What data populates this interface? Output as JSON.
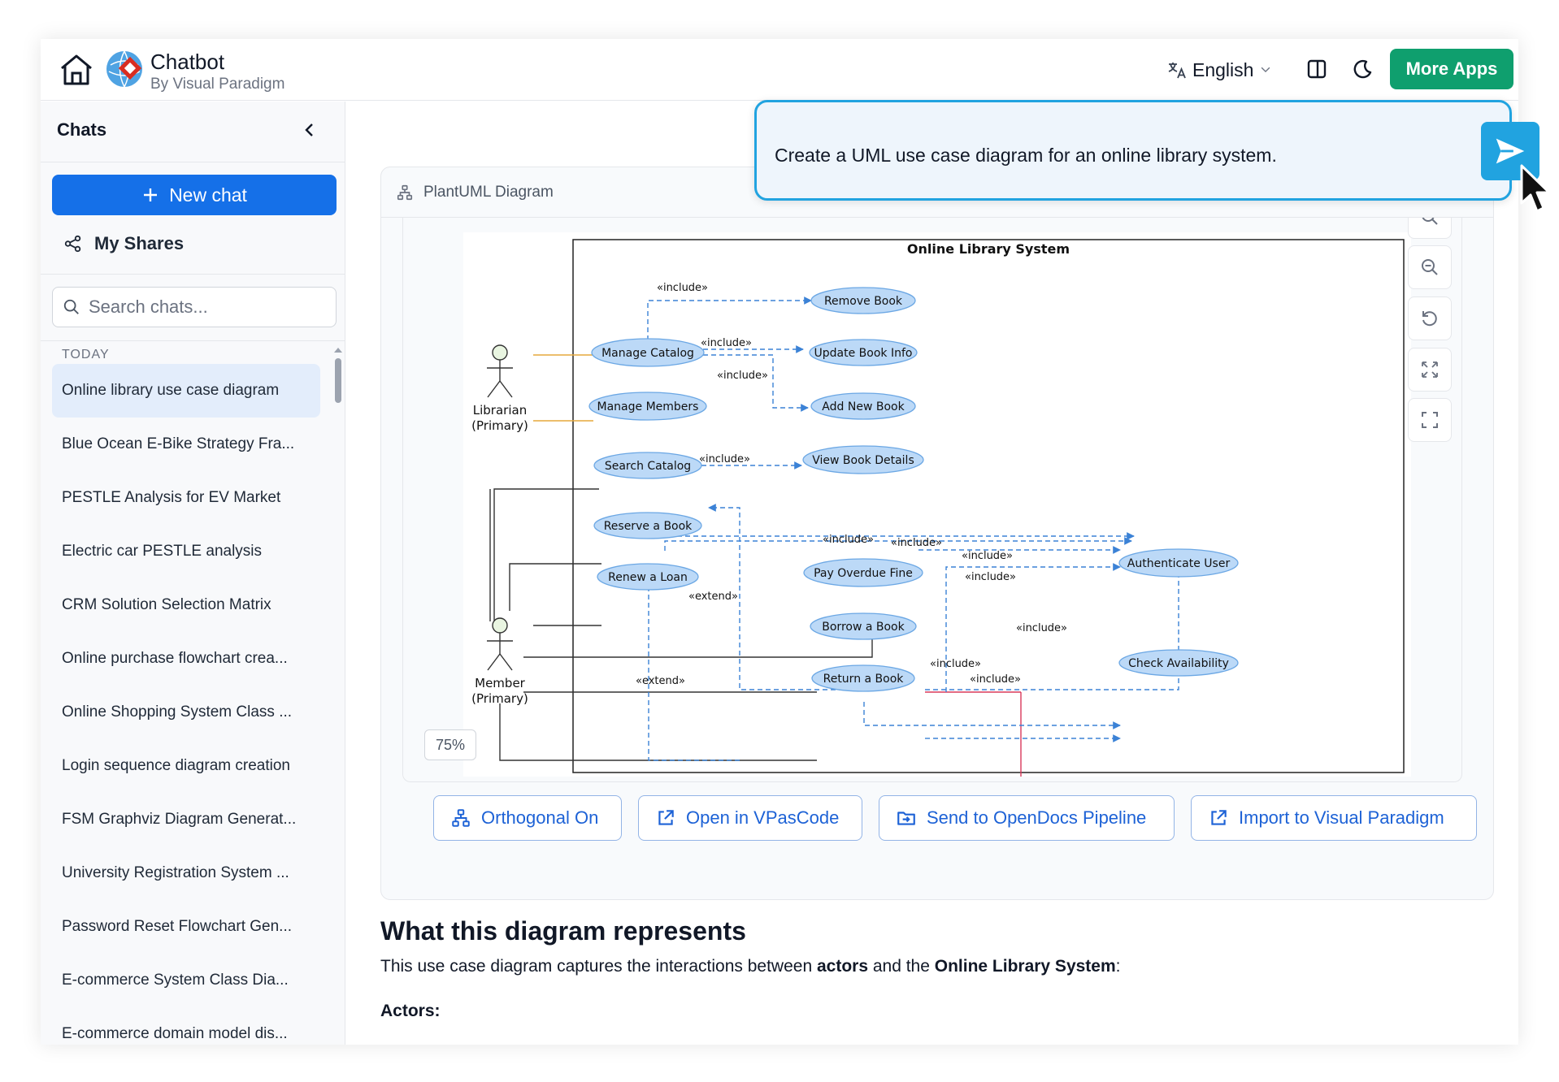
{
  "header": {
    "brand_title": "Chatbot",
    "brand_subtitle": "By Visual Paradigm",
    "language": "English",
    "more_apps": "More Apps"
  },
  "sidebar": {
    "heading": "Chats",
    "new_chat": "New chat",
    "my_shares": "My Shares",
    "search_placeholder": "Search chats...",
    "section_label": "TODAY",
    "items": [
      "Online library use case diagram",
      "Blue Ocean E-Bike Strategy Fra...",
      "PESTLE Analysis for EV Market",
      "Electric car PESTLE analysis",
      "CRM Solution Selection Matrix",
      "Online purchase flowchart crea...",
      "Online Shopping System Class ...",
      "Login sequence diagram creation",
      "FSM Graphviz Diagram Generat...",
      "University Registration System ...",
      "Password Reset Flowchart Gen...",
      "E-commerce System Class Dia...",
      "E-commerce domain model dis..."
    ]
  },
  "card": {
    "title": "PlantUML Diagram",
    "zoom": "75%",
    "actions": {
      "orthogonal": "Orthogonal On",
      "open_vpascode": "Open in VPasCode",
      "send_opendocs": "Send to OpenDocs Pipeline",
      "import_vp": "Import to Visual Paradigm"
    }
  },
  "diagram": {
    "system_title": "Online Library System",
    "actors": {
      "librarian": [
        "Librarian",
        "(Primary)"
      ],
      "member": [
        "Member",
        "(Primary)"
      ]
    },
    "use_cases": {
      "remove_book": "Remove Book",
      "manage_catalog": "Manage Catalog",
      "update_book_info": "Update Book Info",
      "manage_members": "Manage Members",
      "add_new_book": "Add New Book",
      "search_catalog": "Search Catalog",
      "view_book_details": "View Book Details",
      "reserve_book": "Reserve a Book",
      "authenticate_user": "Authenticate User",
      "renew_loan": "Renew a Loan",
      "pay_overdue_fine": "Pay Overdue Fine",
      "borrow_book": "Borrow a Book",
      "check_availability": "Check Availability",
      "return_book": "Return a Book"
    },
    "include": "«include»",
    "extend": "«extend»"
  },
  "content": {
    "heading": "What this diagram represents",
    "desc_prefix": "This use case diagram captures the interactions between ",
    "desc_bold1": "actors",
    "desc_mid": " and the ",
    "desc_bold2": "Online Library System",
    "desc_suffix": ":",
    "actors_label": "Actors:"
  },
  "prompt": {
    "text": "Create a UML use case diagram for an online library system."
  },
  "colors": {
    "primary": "#1570e8",
    "more_apps": "#0f9f6e",
    "prompt_border": "#21a3e0",
    "usecase_fill": "#bcd9f7",
    "dependency": "#3b82d6"
  }
}
